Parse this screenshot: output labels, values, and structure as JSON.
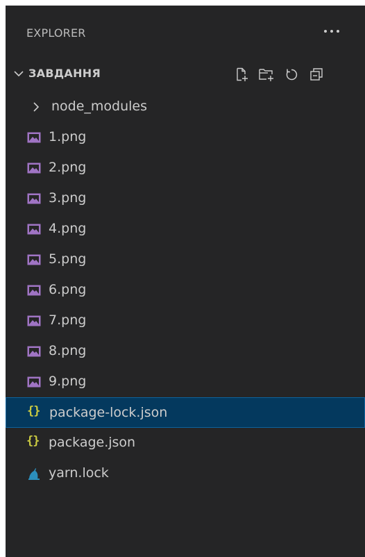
{
  "explorer": {
    "title": "EXPLORER",
    "more_actions_icon": "ellipsis-icon"
  },
  "section": {
    "title": "ЗАВДАННЯ",
    "expanded": true,
    "actions": [
      {
        "name": "new-file-icon",
        "label": "New File"
      },
      {
        "name": "new-folder-icon",
        "label": "New Folder"
      },
      {
        "name": "refresh-icon",
        "label": "Refresh Explorer"
      },
      {
        "name": "collapse-all-icon",
        "label": "Collapse Folders in Explorer"
      }
    ]
  },
  "tree": {
    "items": [
      {
        "label": "node_modules",
        "kind": "folder",
        "icon": "chevron-right-icon"
      },
      {
        "label": "1.png",
        "kind": "image",
        "icon": "image-file-icon"
      },
      {
        "label": "2.png",
        "kind": "image",
        "icon": "image-file-icon"
      },
      {
        "label": "3.png",
        "kind": "image",
        "icon": "image-file-icon"
      },
      {
        "label": "4.png",
        "kind": "image",
        "icon": "image-file-icon"
      },
      {
        "label": "5.png",
        "kind": "image",
        "icon": "image-file-icon"
      },
      {
        "label": "6.png",
        "kind": "image",
        "icon": "image-file-icon"
      },
      {
        "label": "7.png",
        "kind": "image",
        "icon": "image-file-icon"
      },
      {
        "label": "8.png",
        "kind": "image",
        "icon": "image-file-icon"
      },
      {
        "label": "9.png",
        "kind": "image",
        "icon": "image-file-icon"
      },
      {
        "label": "package-lock.json",
        "kind": "json",
        "icon": "json-file-icon",
        "selected": true
      },
      {
        "label": "package.json",
        "kind": "json",
        "icon": "json-file-icon"
      },
      {
        "label": "yarn.lock",
        "kind": "yarn",
        "icon": "yarn-file-icon"
      }
    ]
  },
  "colors": {
    "panel_bg": "#252526",
    "text": "#cccccc",
    "selection_bg": "#04395e",
    "selection_border": "#0e639c",
    "image_icon": "#a074c4",
    "json_icon": "#cbcb41",
    "yarn_icon": "#2c8ebb"
  }
}
